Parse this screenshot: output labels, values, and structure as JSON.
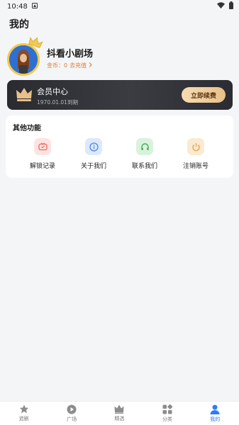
{
  "status_bar": {
    "time": "10:48"
  },
  "header": {
    "title": "我的"
  },
  "profile": {
    "username": "抖看小剧场",
    "coins_label": "金币：0",
    "recharge_label": "去充值"
  },
  "vip": {
    "title": "会员中心",
    "expiry": "1970.01.01到期",
    "renew_label": "立即续费"
  },
  "features": {
    "title": "其他功能",
    "items": [
      {
        "label": "解锁记录",
        "icon": "tv-icon",
        "bg": "#fde3e1",
        "fg": "#e96a60"
      },
      {
        "label": "关于我们",
        "icon": "info-icon",
        "bg": "#dde8fb",
        "fg": "#4c86ea"
      },
      {
        "label": "联系我们",
        "icon": "headset-icon",
        "bg": "#daf2dc",
        "fg": "#3daf57"
      },
      {
        "label": "注销账号",
        "icon": "power-icon",
        "bg": "#fbead2",
        "fg": "#e6a04a"
      }
    ]
  },
  "tabbar": {
    "items": [
      {
        "label": "追剧",
        "icon": "star-icon",
        "active": false
      },
      {
        "label": "广场",
        "icon": "play-icon",
        "active": false
      },
      {
        "label": "精选",
        "icon": "crown-icon",
        "active": false
      },
      {
        "label": "分类",
        "icon": "grid-icon",
        "active": false
      },
      {
        "label": "我的",
        "icon": "user-icon",
        "active": true
      }
    ]
  },
  "colors": {
    "accent": "#2d7cf6",
    "coin": "#e07a2c",
    "vip_gold": "#e8c08a"
  }
}
